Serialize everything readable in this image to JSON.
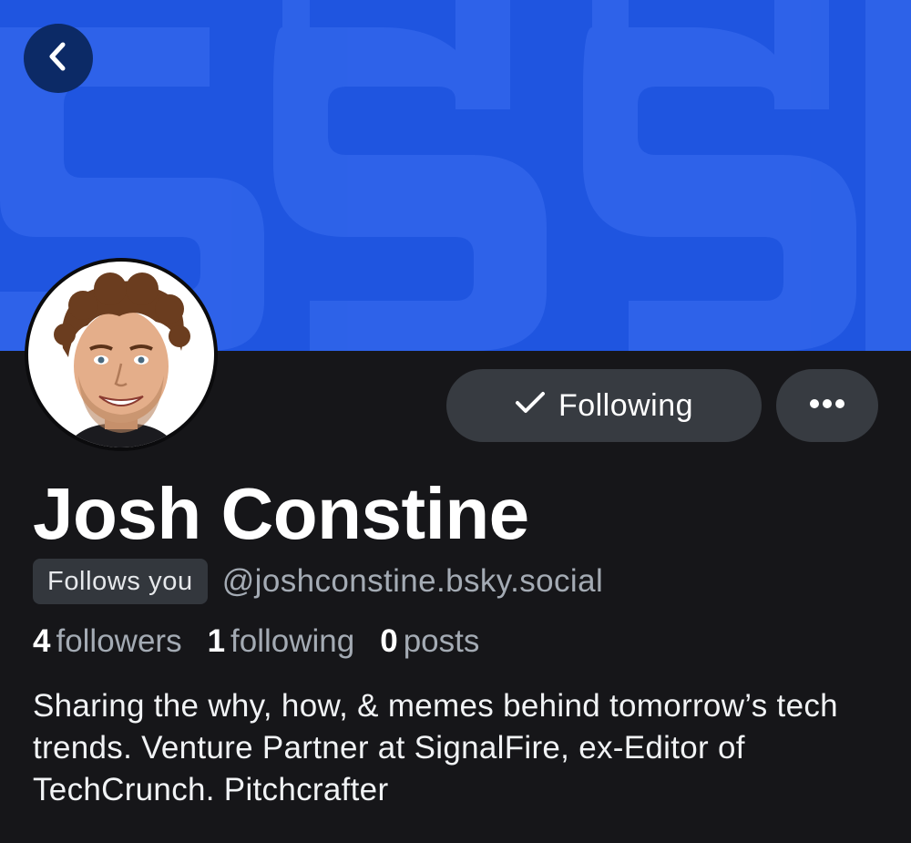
{
  "colors": {
    "banner_blue": "#1f55e0",
    "banner_letter": "#3a6ef0",
    "background": "#161619",
    "button_bg": "#373b41",
    "back_button_bg": "#0c2a66",
    "muted_text": "#a4abb4"
  },
  "header": {
    "back_icon": "chevron-left-icon"
  },
  "actions": {
    "following_label": "Following",
    "following_icon": "check-icon",
    "more_icon": "ellipsis-icon"
  },
  "profile": {
    "display_name": "Josh Constine",
    "follows_you_badge": "Follows you",
    "handle": "@joshconstine.bsky.social",
    "stats": {
      "followers_count": "4",
      "followers_label": "followers",
      "following_count": "1",
      "following_label": "following",
      "posts_count": "0",
      "posts_label": "posts"
    },
    "bio": "Sharing the why, how, & memes behind tomorrow’s tech trends. Venture Partner at SignalFire, ex-Editor of TechCrunch. Pitchcrafter"
  }
}
